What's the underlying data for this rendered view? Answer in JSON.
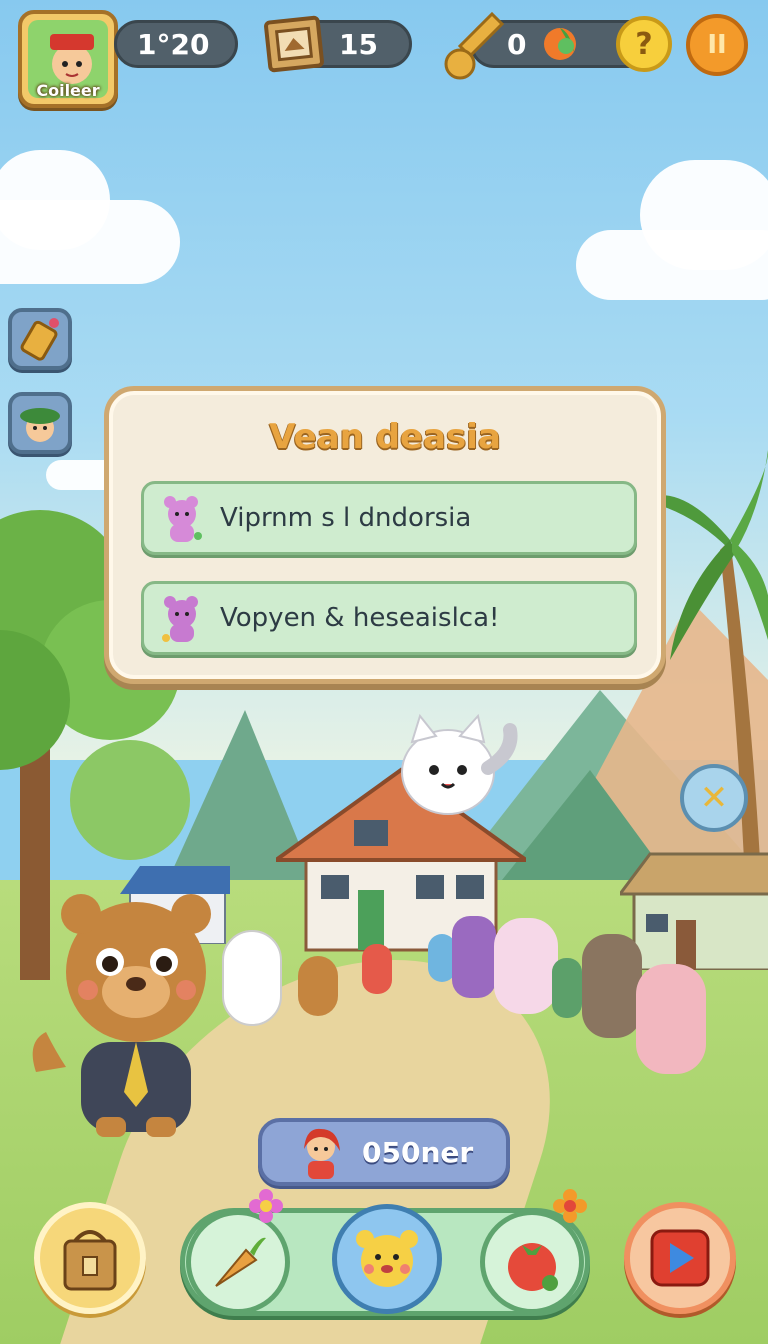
{
  "hud": {
    "avatar_label": "Coileer",
    "coins": "1°20",
    "crates": "15",
    "keys": "0",
    "help_symbol": "?",
    "pause_symbol": "II"
  },
  "dialog": {
    "title": "Vean deasia",
    "options": [
      {
        "label": "Viprnm s l dndorsia",
        "icon": "pink-bear-icon"
      },
      {
        "label": "Vopyen & heseaislca!",
        "icon": "purple-bear-icon"
      }
    ]
  },
  "close_symbol": "✕",
  "player_name": "050ner",
  "bottom_bar": {
    "left": "inventory-bag-icon",
    "slots": [
      "carrot-icon",
      "bear-face-icon",
      "tomato-icon"
    ],
    "right": "play-icon"
  },
  "colors": {
    "sky": "#87c9ef",
    "dialog_bg": "#f4ecdc",
    "title": "#e8a440",
    "option_bg": "#cfeccf",
    "hud_pill": "#51606a",
    "accent_orange": "#f39a2a",
    "accent_yellow": "#f7cf3c"
  }
}
